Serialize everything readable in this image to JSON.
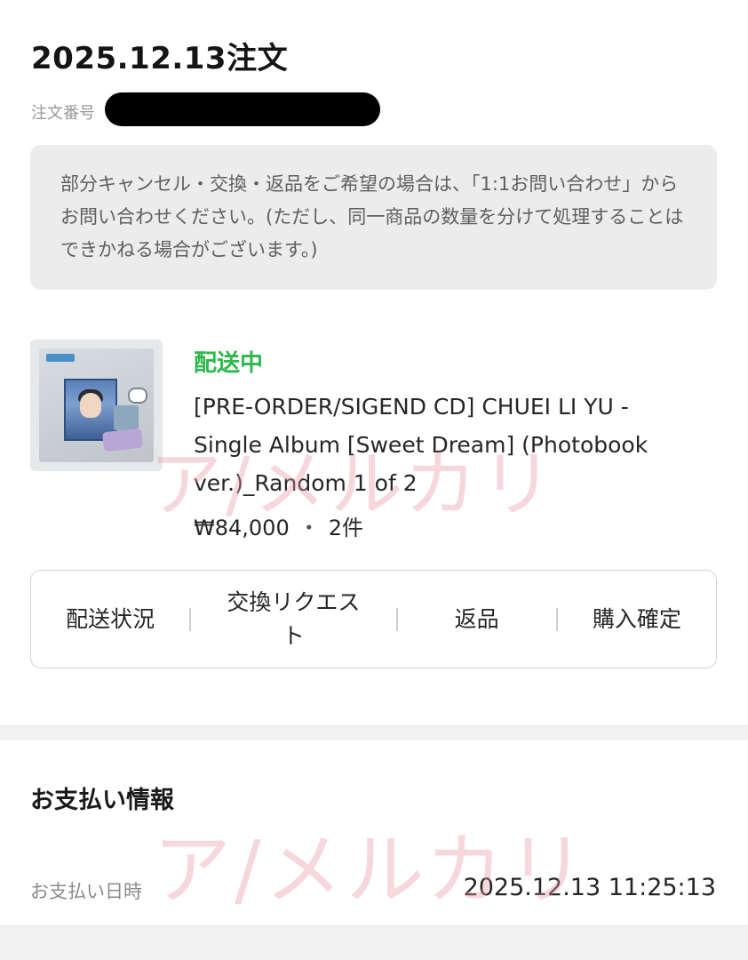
{
  "order": {
    "title": "2025.12.13注文",
    "number_label": "注文番号",
    "notice": "部分キャンセル・交換・返品をご希望の場合は、「1:1お問い合わせ」からお問い合わせください。(ただし、同一商品の数量を分けて処理することはできかねる場合がございます。)"
  },
  "item": {
    "status": "配送中",
    "status_color": "#2db84d",
    "name": "[PRE-ORDER/SIGEND CD] CHUEI LI YU - Single Album [Sweet Dream] (Photobook ver.)_Random 1 of 2",
    "price": "₩84,000",
    "separator": "・",
    "quantity": "2件"
  },
  "actions": {
    "shipping_status": "配送状況",
    "exchange_request": "交換リクエスト",
    "return": "返品",
    "confirm_purchase": "購入確定"
  },
  "payment": {
    "title": "お支払い情報",
    "date_label": "お支払い日時",
    "date_value": "2025.12.13 11:25:13"
  },
  "watermark": {
    "text": "ア/メルカリ"
  }
}
